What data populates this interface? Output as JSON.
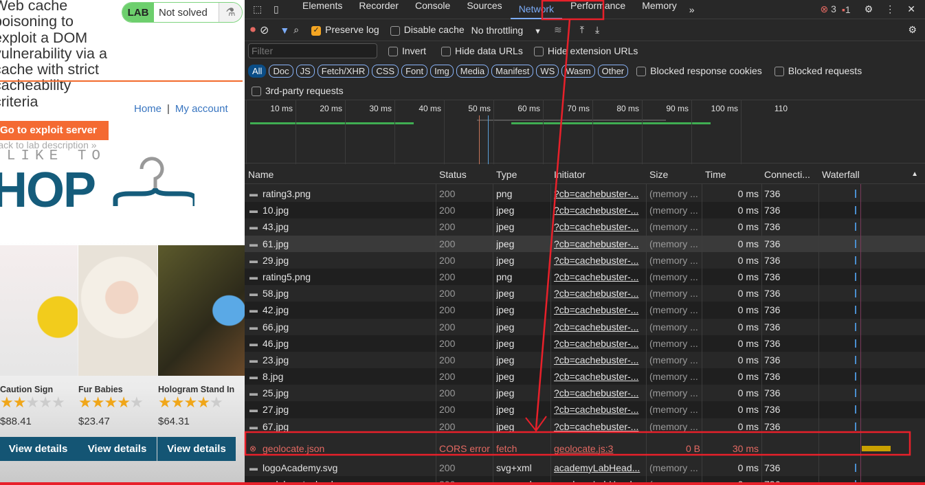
{
  "lab_page": {
    "title": "Web cache poisoning to exploit a DOM vulnerability via a cache with strict cacheability criteria",
    "badge": {
      "label": "LAB",
      "status": "Not solved",
      "icon": "flask-icon"
    },
    "nav": {
      "home": "Home",
      "separator": "|",
      "account": "My account"
    },
    "exploit_button": "Go to exploit server",
    "back_link": "Back to lab description",
    "logo": {
      "top": "WE LIKE TO",
      "bottom": "SHOP"
    },
    "products": [
      {
        "name": "Caution Sign",
        "rating": 2,
        "price": "$88.41",
        "button": "View details"
      },
      {
        "name": "Fur Babies",
        "rating": 4,
        "price": "$23.47",
        "button": "View details"
      },
      {
        "name": "Hologram Stand In",
        "rating": 4,
        "price": "$64.31",
        "button": "View details"
      }
    ],
    "star_color": "#f0a619"
  },
  "devtools": {
    "tabs": [
      "Elements",
      "Recorder",
      "Console",
      "Sources",
      "Network",
      "Performance",
      "Memory"
    ],
    "active_tab": "Network",
    "more": "»",
    "errors": "3",
    "issues": "1",
    "toolbar": {
      "preserve_log": "Preserve log",
      "disable_cache": "Disable cache",
      "throttling": "No throttling"
    },
    "filter": {
      "placeholder": "Filter",
      "invert": "Invert",
      "hide_data": "Hide data URLs",
      "hide_ext": "Hide extension URLs"
    },
    "chips": [
      "All",
      "Doc",
      "JS",
      "Fetch/XHR",
      "CSS",
      "Font",
      "Img",
      "Media",
      "Manifest",
      "WS",
      "Wasm",
      "Other"
    ],
    "blocked_cookies": "Blocked response cookies",
    "blocked_requests": "Blocked requests",
    "third_party": "3rd-party requests",
    "timeline_ticks": [
      "10 ms",
      "20 ms",
      "30 ms",
      "40 ms",
      "50 ms",
      "60 ms",
      "70 ms",
      "80 ms",
      "90 ms",
      "100 ms",
      "110"
    ],
    "columns": [
      "Name",
      "Status",
      "Type",
      "Initiator",
      "Size",
      "Time",
      "Connecti...",
      "Waterfall"
    ],
    "rows": [
      {
        "name": "rating3.png",
        "status": "200",
        "type": "png",
        "initiator": "?cb=cachebuster-...",
        "size": "(memory ...",
        "time": "0 ms",
        "conn": "736"
      },
      {
        "name": "10.jpg",
        "status": "200",
        "type": "jpeg",
        "initiator": "?cb=cachebuster-...",
        "size": "(memory ...",
        "time": "0 ms",
        "conn": "736"
      },
      {
        "name": "43.jpg",
        "status": "200",
        "type": "jpeg",
        "initiator": "?cb=cachebuster-...",
        "size": "(memory ...",
        "time": "0 ms",
        "conn": "736"
      },
      {
        "name": "61.jpg",
        "status": "200",
        "type": "jpeg",
        "initiator": "?cb=cachebuster-...",
        "size": "(memory ...",
        "time": "0 ms",
        "conn": "736"
      },
      {
        "name": "29.jpg",
        "status": "200",
        "type": "jpeg",
        "initiator": "?cb=cachebuster-...",
        "size": "(memory ...",
        "time": "0 ms",
        "conn": "736"
      },
      {
        "name": "rating5.png",
        "status": "200",
        "type": "png",
        "initiator": "?cb=cachebuster-...",
        "size": "(memory ...",
        "time": "0 ms",
        "conn": "736"
      },
      {
        "name": "58.jpg",
        "status": "200",
        "type": "jpeg",
        "initiator": "?cb=cachebuster-...",
        "size": "(memory ...",
        "time": "0 ms",
        "conn": "736"
      },
      {
        "name": "42.jpg",
        "status": "200",
        "type": "jpeg",
        "initiator": "?cb=cachebuster-...",
        "size": "(memory ...",
        "time": "0 ms",
        "conn": "736"
      },
      {
        "name": "66.jpg",
        "status": "200",
        "type": "jpeg",
        "initiator": "?cb=cachebuster-...",
        "size": "(memory ...",
        "time": "0 ms",
        "conn": "736"
      },
      {
        "name": "46.jpg",
        "status": "200",
        "type": "jpeg",
        "initiator": "?cb=cachebuster-...",
        "size": "(memory ...",
        "time": "0 ms",
        "conn": "736"
      },
      {
        "name": "23.jpg",
        "status": "200",
        "type": "jpeg",
        "initiator": "?cb=cachebuster-...",
        "size": "(memory ...",
        "time": "0 ms",
        "conn": "736"
      },
      {
        "name": "8.jpg",
        "status": "200",
        "type": "jpeg",
        "initiator": "?cb=cachebuster-...",
        "size": "(memory ...",
        "time": "0 ms",
        "conn": "736"
      },
      {
        "name": "25.jpg",
        "status": "200",
        "type": "jpeg",
        "initiator": "?cb=cachebuster-...",
        "size": "(memory ...",
        "time": "0 ms",
        "conn": "736"
      },
      {
        "name": "27.jpg",
        "status": "200",
        "type": "jpeg",
        "initiator": "?cb=cachebuster-...",
        "size": "(memory ...",
        "time": "0 ms",
        "conn": "736"
      },
      {
        "name": "67.jpg",
        "status": "200",
        "type": "jpeg",
        "initiator": "?cb=cachebuster-...",
        "size": "(memory ...",
        "time": "0 ms",
        "conn": "736"
      },
      {
        "name": "geolocate.json",
        "status": "CORS error",
        "type": "fetch",
        "initiator": "geolocate.js:3",
        "size": "0 B",
        "time": "30 ms",
        "conn": "",
        "error": true
      },
      {
        "name": "logoAcademy.svg",
        "status": "200",
        "type": "svg+xml",
        "initiator": "academyLabHead...",
        "size": "(memory ...",
        "time": "0 ms",
        "conn": "736"
      },
      {
        "name": "ps-lab-notsolved.svg",
        "status": "200",
        "type": "svg+xml",
        "initiator": "academyLabHead...",
        "size": "(memory ...",
        "time": "0 ms",
        "conn": "736"
      }
    ],
    "hovered_row": "61.jpg",
    "annotation_color": "#e8202a"
  }
}
